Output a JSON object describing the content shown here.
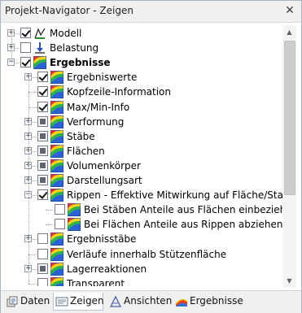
{
  "window": {
    "title": "Projekt-Navigator - Zeigen",
    "close_glyph": "✕"
  },
  "tree": [
    {
      "label": "Modell",
      "level": 0,
      "expander": "plus",
      "check": "checked",
      "icon": "model-icon",
      "bold": false
    },
    {
      "label": "Belastung",
      "level": 0,
      "expander": "plus",
      "check": "none",
      "icon": "load-icon",
      "bold": false
    },
    {
      "label": "Ergebnisse",
      "level": 0,
      "expander": "minus",
      "check": "checked",
      "icon": "results-icon",
      "bold": true
    },
    {
      "label": "Ergebniswerte",
      "level": 1,
      "expander": "plus",
      "check": "checked",
      "icon": "results-icon",
      "bold": false
    },
    {
      "label": "Kopfzeile-Information",
      "level": 1,
      "expander": "none",
      "check": "checked",
      "icon": "results-icon",
      "bold": false
    },
    {
      "label": "Max/Min-Info",
      "level": 1,
      "expander": "none",
      "check": "checked",
      "icon": "results-icon",
      "bold": false
    },
    {
      "label": "Verformung",
      "level": 1,
      "expander": "plus",
      "check": "partial",
      "icon": "results-icon",
      "bold": false
    },
    {
      "label": "Stäbe",
      "level": 1,
      "expander": "plus",
      "check": "partial",
      "icon": "results-icon",
      "bold": false
    },
    {
      "label": "Flächen",
      "level": 1,
      "expander": "plus",
      "check": "partial",
      "icon": "results-icon",
      "bold": false
    },
    {
      "label": "Volumenkörper",
      "level": 1,
      "expander": "plus",
      "check": "partial",
      "icon": "results-icon",
      "bold": false
    },
    {
      "label": "Darstellungsart",
      "level": 1,
      "expander": "plus",
      "check": "partial",
      "icon": "results-icon",
      "bold": false
    },
    {
      "label": "Rippen - Effektive Mitwirkung auf Fläche/Stab",
      "level": 1,
      "expander": "minus",
      "check": "checked",
      "icon": "results-icon",
      "bold": false
    },
    {
      "label": "Bei Stäben Anteile aus Flächen einbeziehen",
      "level": 2,
      "expander": "none",
      "check": "none",
      "icon": "results-icon",
      "bold": false
    },
    {
      "label": "Bei Flächen Anteile aus Rippen abziehen",
      "level": 2,
      "expander": "none",
      "check": "none",
      "icon": "results-icon",
      "bold": false
    },
    {
      "label": "Ergebnisstäbe",
      "level": 1,
      "expander": "plus",
      "check": "none",
      "icon": "results-icon",
      "bold": false
    },
    {
      "label": "Verläufe innerhalb Stützenfläche",
      "level": 1,
      "expander": "none",
      "check": "none",
      "icon": "results-icon",
      "bold": false
    },
    {
      "label": "Lagerreaktionen",
      "level": 1,
      "expander": "plus",
      "check": "partial",
      "icon": "results-icon",
      "bold": false
    },
    {
      "label": "Transparent",
      "level": 1,
      "expander": "none",
      "check": "none",
      "icon": "results-icon",
      "bold": false
    }
  ],
  "scrollbar": {
    "up_glyph": "▲",
    "down_glyph": "▼"
  },
  "tabs": [
    {
      "label": "Daten",
      "icon": "data-icon",
      "active": false
    },
    {
      "label": "Zeigen",
      "icon": "display-icon",
      "active": true
    },
    {
      "label": "Ansichten",
      "icon": "views-icon",
      "active": false
    },
    {
      "label": "Ergebnisse",
      "icon": "results-tab-icon",
      "active": false
    }
  ]
}
